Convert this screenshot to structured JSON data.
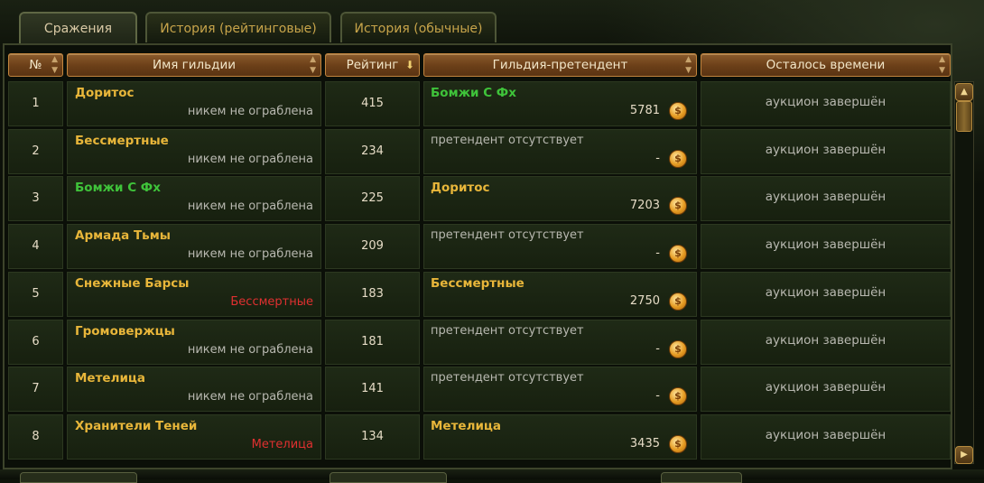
{
  "tabs": [
    {
      "label": "Сражения",
      "active": true
    },
    {
      "label": "История (рейтинговые)",
      "active": false
    },
    {
      "label": "История (обычные)",
      "active": false
    }
  ],
  "columns": {
    "num": "№",
    "guild": "Имя гильдии",
    "rating": "Рейтинг",
    "contender": "Гильдия-претендент",
    "time_left": "Осталось времени"
  },
  "coin_icon": "gold-coin-icon",
  "rows": [
    {
      "num": "1",
      "guild": "Доритос",
      "guild_color": "gold",
      "robbed": "никем не ограблена",
      "robbed_color": "gray",
      "rating": "415",
      "contender": "Бомжи С Фх",
      "contender_color": "green",
      "bid": "5781",
      "time": "аукцион завершён"
    },
    {
      "num": "2",
      "guild": "Бессмертные",
      "guild_color": "gold",
      "robbed": "никем не ограблена",
      "robbed_color": "gray",
      "rating": "234",
      "contender": "претендент отсутствует",
      "contender_color": "none",
      "bid": "-",
      "time": "аукцион завершён"
    },
    {
      "num": "3",
      "guild": "Бомжи С Фх",
      "guild_color": "green",
      "robbed": "никем не ограблена",
      "robbed_color": "gray",
      "rating": "225",
      "contender": "Доритос",
      "contender_color": "gold",
      "bid": "7203",
      "time": "аукцион завершён"
    },
    {
      "num": "4",
      "guild": "Армада Тьмы",
      "guild_color": "gold",
      "robbed": "никем не ограблена",
      "robbed_color": "gray",
      "rating": "209",
      "contender": "претендент отсутствует",
      "contender_color": "none",
      "bid": "-",
      "time": "аукцион завершён"
    },
    {
      "num": "5",
      "guild": "Снежные Барсы",
      "guild_color": "gold",
      "robbed": "Бессмертные",
      "robbed_color": "red",
      "rating": "183",
      "contender": "Бессмертные",
      "contender_color": "gold",
      "bid": "2750",
      "time": "аукцион завершён"
    },
    {
      "num": "6",
      "guild": "Громовержцы",
      "guild_color": "gold",
      "robbed": "никем не ограблена",
      "robbed_color": "gray",
      "rating": "181",
      "contender": "претендент отсутствует",
      "contender_color": "none",
      "bid": "-",
      "time": "аукцион завершён"
    },
    {
      "num": "7",
      "guild": "Метелица",
      "guild_color": "gold",
      "robbed": "никем не ограблена",
      "robbed_color": "gray",
      "rating": "141",
      "contender": "претендент отсутствует",
      "contender_color": "none",
      "bid": "-",
      "time": "аукцион завершён"
    },
    {
      "num": "8",
      "guild": "Хранители Теней",
      "guild_color": "gold",
      "robbed": "Метелица",
      "robbed_color": "red",
      "rating": "134",
      "contender": "Метелица",
      "contender_color": "gold",
      "bid": "3435",
      "time": "аукцион завершён"
    }
  ],
  "colors": {
    "gold_text": "#e8b63a",
    "green_text": "#3fc33a",
    "red_text": "#e03030",
    "header_bg": "#6b3f18"
  }
}
